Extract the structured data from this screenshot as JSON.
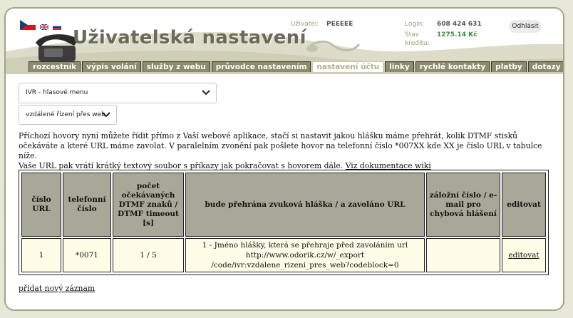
{
  "header": {
    "title": "Uživatelská nastavení",
    "user_label": "Uživatel:",
    "user_value": "PEEEEE",
    "login_label": "Login:",
    "login_value": "608 424 631",
    "credit_label": "Stav kreditu:",
    "credit_value": "1275.14 Kč",
    "logout_label": "Odhlásit",
    "flags": [
      "flag-czech-icon",
      "flag-uk-icon",
      "flag-russia-icon"
    ]
  },
  "nav": {
    "tabs": [
      {
        "label": "rozcestník"
      },
      {
        "label": "výpis volání"
      },
      {
        "label": "služby z webu"
      },
      {
        "label": "průvodce nastavením"
      },
      {
        "label": "nastavení účtu",
        "active": true
      },
      {
        "label": "linky"
      },
      {
        "label": "rychlé kontakty"
      },
      {
        "label": "platby"
      },
      {
        "label": "dotazy"
      }
    ]
  },
  "selects": {
    "ivr": "IVR - hlasové menu",
    "remote": "vzdálené řízení přes web"
  },
  "description": {
    "line1": "Příchozí hovory nyní můžete řídit přímo z Vaší webové aplikace, stačí si nastavit jakou hlášku máme přehrát, kolik DTMF stisků očekáváte a které URL máme zavolat. V paralelním zvonění pak pošlete hovor na telefonní číslo *007XX kde XX je číslo URL v tabulce níže.",
    "line2": "Vaše URL pak vrátí krátký textový soubor s příkazy jak pokračovat s hovorem dále.",
    "doc_link": "Viz dokumentace wiki"
  },
  "table": {
    "headers": {
      "number": "číslo URL",
      "phone": "telefonní číslo",
      "dtmf": "počet očekávaných DTMF znaků / DTMF timeout [s]",
      "sound": "bude přehrána zvuková hláška / a zavoláno URL",
      "backup": "záložní číslo / e-mail pro chybová hlášení",
      "edit": "editovat"
    },
    "rows": [
      {
        "number": "1",
        "phone": "*0071",
        "dtmf": "1 / 5",
        "sound": "1 - Jméno hlášky, která se přehraje před zavoláním url",
        "url1": "http://www.odorik.cz/w/_export",
        "url2": "/code/ivr:vzdalene_rizeni_pres_web?codeblock=0",
        "backup": "",
        "edit": "editovat"
      }
    ]
  },
  "add_record": "přidat nový záznam"
}
